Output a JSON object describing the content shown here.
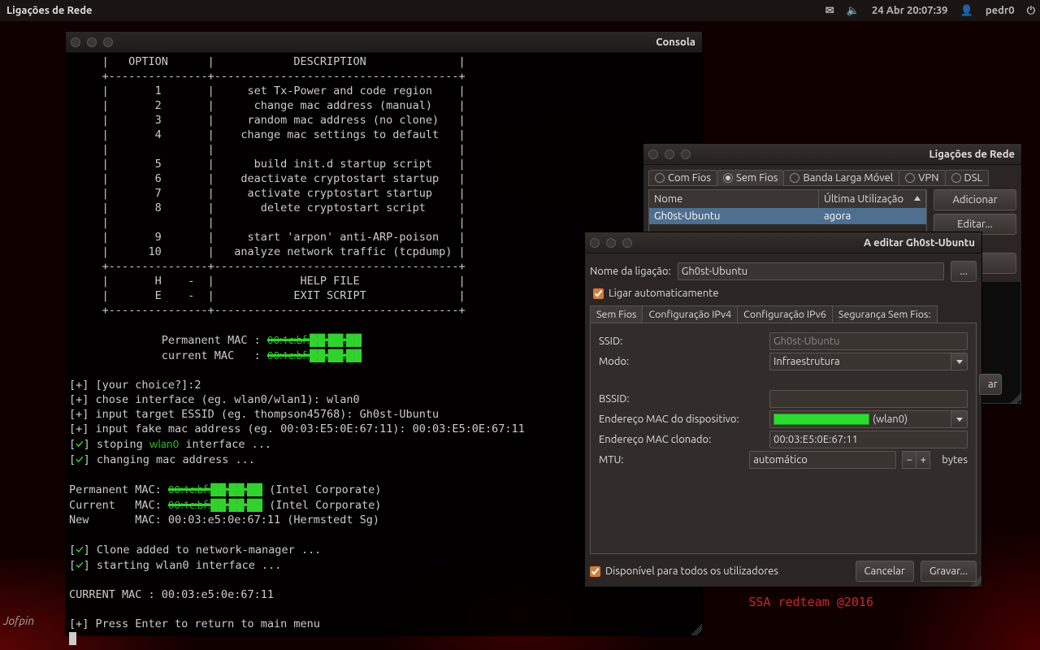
{
  "panel": {
    "active_app": "Ligações de Rede",
    "clock": "24 Abr 20:07:39",
    "user": "pedr0"
  },
  "desktop": {
    "watermark": "SSA redteam @2016"
  },
  "terminal": {
    "title": "Consola",
    "header_option": "OPTION",
    "header_desc": "DESCRIPTION",
    "menu": [
      {
        "n": "1",
        "d": "set Tx-Power and code region"
      },
      {
        "n": "2",
        "d": "change mac address (manual)"
      },
      {
        "n": "3",
        "d": "random mac address (no clone)"
      },
      {
        "n": "4",
        "d": "change mac settings to default"
      },
      {
        "n": "",
        "d": ""
      },
      {
        "n": "5",
        "d": "build init.d startup script"
      },
      {
        "n": "6",
        "d": "deactivate cryptostart startup"
      },
      {
        "n": "7",
        "d": "activate cryptostart startup"
      },
      {
        "n": "8",
        "d": "delete cryptostart script"
      },
      {
        "n": "",
        "d": ""
      },
      {
        "n": "9",
        "d": "start 'arpon' anti-ARP-poison"
      },
      {
        "n": "10",
        "d": "analyze network traffic (tcpdump)"
      },
      {
        "n": "",
        "d": ""
      },
      {
        "n": "H",
        "d": "HELP FILE",
        "sep": "-"
      },
      {
        "n": "E",
        "d": "EXIT SCRIPT",
        "sep": "-"
      }
    ],
    "perm_lbl": "Permanent MAC :",
    "curr_lbl": "current MAC   :",
    "mac_redacted": "00:1c:bf:██:██:██",
    "lines": {
      "choice": "[+] [your choice?]:2",
      "iface": "[+] chose interface (eg. wlan0/wlan1): wlan0",
      "essid": "[+] input target ESSID (eg. thompson45768): Gh0st-Ubuntu",
      "fakemac": "[+] input fake mac address (eg. 00:03:E5:0E:67:11): 00:03:E5:0E:67:11",
      "stopping": "stoping ",
      "wlan0": "wlan0",
      "stopping2": " interface ...",
      "changing": "changing mac address ...",
      "pmac": "Permanent MAC: ",
      "cmac": "Current   MAC: ",
      "nmac": "New       MAC: 00:03:e5:0e:67:11 (Hermstedt Sg)",
      "intel": " (Intel Corporate)",
      "clone": "Clone added to network-manager ...",
      "starting": "starting wlan0 interface ...",
      "curmac": "CURRENT MAC : 00:03:e5:0e:67:11",
      "press": "[+] Press Enter to return to main menu"
    }
  },
  "nmlist": {
    "title": "Ligações de Rede",
    "tabs": [
      "Com Fios",
      "Sem Fios",
      "Banda Larga Móvel",
      "VPN",
      "DSL"
    ],
    "active_tab": 1,
    "col_name": "Nome",
    "col_last": "Última Utilização",
    "row_name": "Gh0st-Ubuntu",
    "row_last": "agora",
    "btn_add": "Adicionar",
    "btn_edit": "Editar...",
    "btn_more": "...",
    "btn_close": "ar"
  },
  "edit": {
    "title": "A editar Gh0st-Ubuntu",
    "name_lbl": "Nome da ligação:",
    "name_val": "Gh0st-Ubuntu",
    "auto_lbl": "Ligar automaticamente",
    "tabs": [
      "Sem Fios",
      "Configuração IPv4",
      "Configuração IPv6",
      "Segurança Sem Fios:"
    ],
    "ssid_lbl": "SSID:",
    "ssid_val": "Gh0st-Ubuntu",
    "mode_lbl": "Modo:",
    "mode_val": "Infraestrutura",
    "bssid_lbl": "BSSID:",
    "bssid_val": "",
    "devmac_lbl": "Endereço MAC do dispositivo:",
    "devmac_suffix": "(wlan0)",
    "clonemac_lbl": "Endereço MAC clonado:",
    "clonemac_val": "00:03:E5:0E:67:11",
    "mtu_lbl": "MTU:",
    "mtu_val": "automático",
    "mtu_unit": "bytes",
    "avail_lbl": "Disponível para todos os utilizadores",
    "btn_cancel": "Cancelar",
    "btn_save": "Gravar..."
  }
}
